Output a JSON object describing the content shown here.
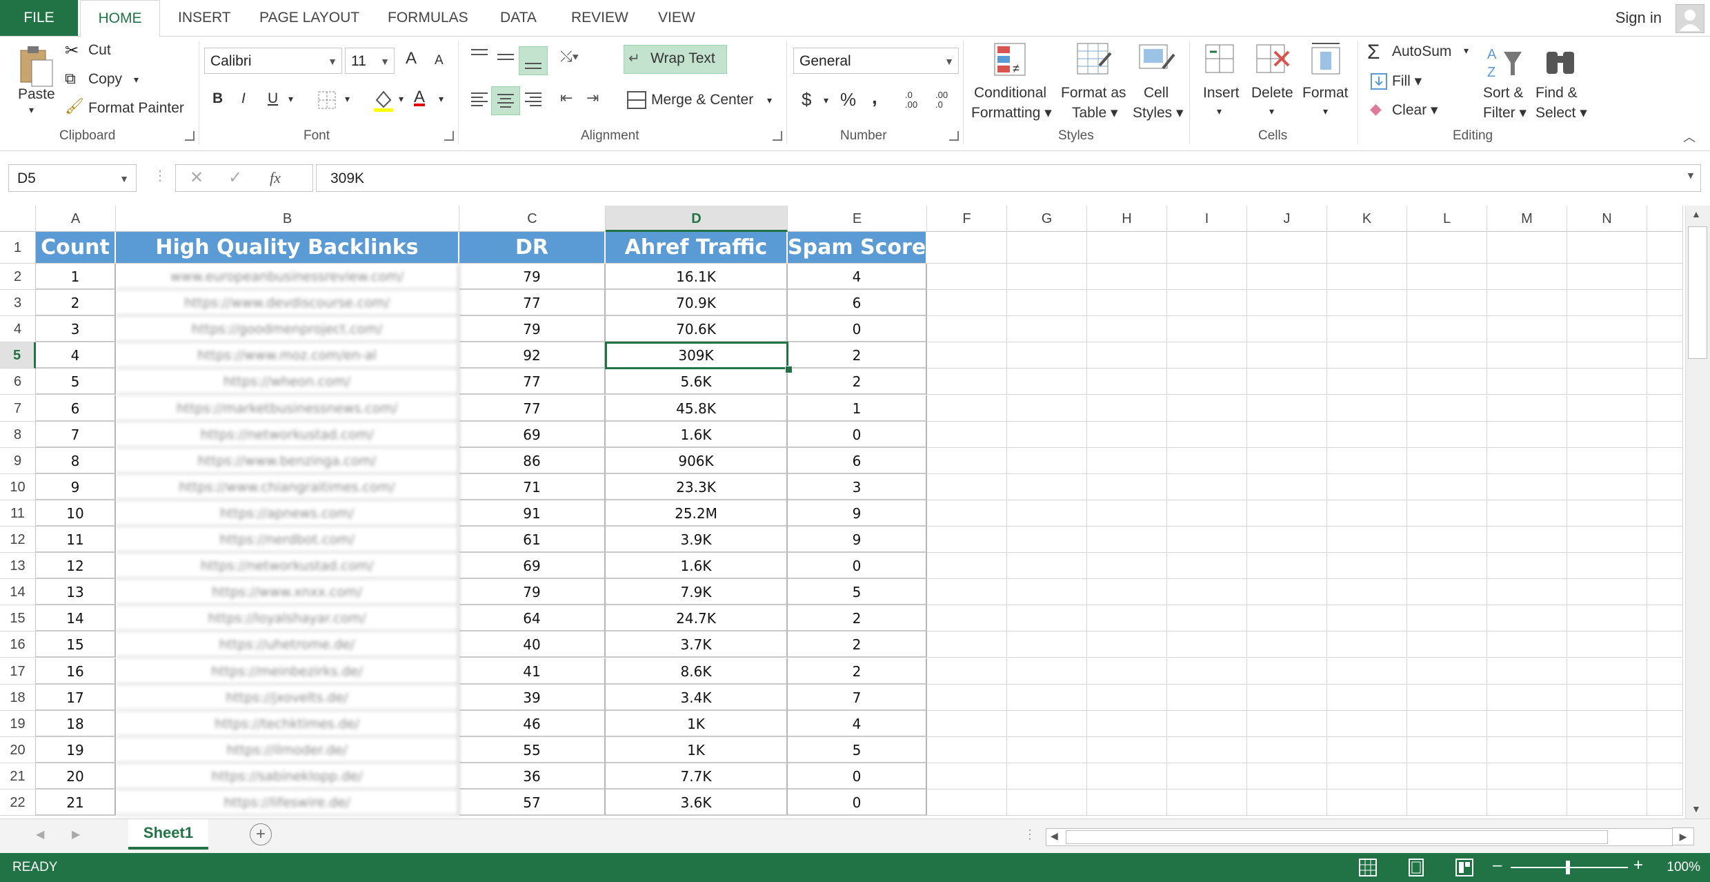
{
  "ribbon_tabs": [
    "FILE",
    "HOME",
    "INSERT",
    "PAGE LAYOUT",
    "FORMULAS",
    "DATA",
    "REVIEW",
    "VIEW"
  ],
  "account": {
    "sign_in": "Sign in"
  },
  "clipboard": {
    "paste": "Paste",
    "cut": "Cut",
    "copy": "Copy",
    "format_painter": "Format Painter",
    "label": "Clipboard"
  },
  "font": {
    "name": "Calibri",
    "size": "11",
    "bold": "B",
    "italic": "I",
    "underline": "U",
    "grow": "A",
    "shrink": "A",
    "font_color": "A",
    "label": "Font"
  },
  "alignment": {
    "wrap_text": "Wrap Text",
    "merge_center": "Merge & Center",
    "label": "Alignment"
  },
  "number": {
    "format": "General",
    "currency": "$",
    "percent": "%",
    "comma": ",",
    "inc_dec": ".0 .00",
    "dec_dec": ".00 .0",
    "label": "Number"
  },
  "styles": {
    "conditional": "Conditional",
    "conditional2": "Formatting",
    "format_as": "Format as",
    "format_as2": "Table",
    "cell": "Cell",
    "cell2": "Styles",
    "label": "Styles"
  },
  "cells": {
    "insert": "Insert",
    "delete": "Delete",
    "format": "Format",
    "label": "Cells"
  },
  "editing": {
    "autosum": "AutoSum",
    "fill": "Fill",
    "clear": "Clear",
    "sort": "Sort &",
    "sort2": "Filter",
    "find": "Find &",
    "find2": "Select",
    "label": "Editing"
  },
  "formula_bar": {
    "name_box": "D5",
    "fx": "fx",
    "content": "309K"
  },
  "columns": [
    "A",
    "B",
    "C",
    "D",
    "E",
    "F",
    "G",
    "H",
    "I",
    "J",
    "K",
    "L",
    "M",
    "N"
  ],
  "selected_column": "D",
  "selected_row": 5,
  "table": {
    "headers": [
      "Count",
      "High Quality Backlinks",
      "DR",
      "Ahref Traffic",
      "Spam Score"
    ],
    "rows": [
      [
        "1",
        "www.europeanbusinessreview.com/",
        "79",
        "16.1K",
        "4"
      ],
      [
        "2",
        "https://www.devdiscourse.com/",
        "77",
        "70.9K",
        "6"
      ],
      [
        "3",
        "https://goodmenproject.com/",
        "79",
        "70.6K",
        "0"
      ],
      [
        "4",
        "https://www.moz.com/en-al",
        "92",
        "309K",
        "2"
      ],
      [
        "5",
        "https://wheon.com/",
        "77",
        "5.6K",
        "2"
      ],
      [
        "6",
        "https://marketbusinessnews.com/",
        "77",
        "45.8K",
        "1"
      ],
      [
        "7",
        "https://networkustad.com/",
        "69",
        "1.6K",
        "0"
      ],
      [
        "8",
        "https://www.benzinga.com/",
        "86",
        "906K",
        "6"
      ],
      [
        "9",
        "https://www.chiangraitimes.com/",
        "71",
        "23.3K",
        "3"
      ],
      [
        "10",
        "https://apnews.com/",
        "91",
        "25.2M",
        "9"
      ],
      [
        "11",
        "https://nerdbot.com/",
        "61",
        "3.9K",
        "9"
      ],
      [
        "12",
        "https://networkustad.com/",
        "69",
        "1.6K",
        "0"
      ],
      [
        "13",
        "https://www.xnxx.com/",
        "79",
        "7.9K",
        "5"
      ],
      [
        "14",
        "https://loyalshayar.com/",
        "64",
        "24.7K",
        "2"
      ],
      [
        "15",
        "https://uhetrome.de/",
        "40",
        "3.7K",
        "2"
      ],
      [
        "16",
        "https://meinbezirks.de/",
        "41",
        "8.6K",
        "2"
      ],
      [
        "17",
        "https://jxovelts.de/",
        "39",
        "3.4K",
        "7"
      ],
      [
        "18",
        "https://techktimes.de/",
        "46",
        "1K",
        "4"
      ],
      [
        "19",
        "https://ilmoder.de/",
        "55",
        "1K",
        "5"
      ],
      [
        "20",
        "https://sabineklopp.de/",
        "36",
        "7.7K",
        "0"
      ],
      [
        "21",
        "https://lifeswire.de/",
        "57",
        "3.6K",
        "0"
      ]
    ]
  },
  "sheet_tabs": [
    "Sheet1"
  ],
  "status": {
    "mode": "READY",
    "zoom": "100%"
  },
  "colors": {
    "accent": "#217346",
    "header_fill": "#5b9bd5"
  },
  "icons": [
    "paste-icon",
    "cut-icon",
    "copy-icon",
    "format-painter-icon",
    "wrap-text-icon",
    "merge-icon",
    "autosum-icon",
    "fill-icon",
    "clear-icon",
    "sort-filter-icon",
    "find-select-icon",
    "add-sheet-icon",
    "normal-view-icon",
    "page-layout-icon",
    "page-break-icon"
  ]
}
